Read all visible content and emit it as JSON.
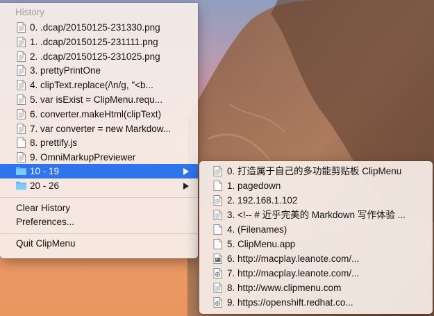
{
  "history_menu": {
    "header": "History",
    "items": [
      {
        "label": "0. .dcap/20150125-231330.png",
        "icon": "text-document-icon"
      },
      {
        "label": "1. .dcap/20150125-231111.png",
        "icon": "text-document-icon"
      },
      {
        "label": "2. .dcap/20150125-231025.png",
        "icon": "text-document-icon"
      },
      {
        "label": "3. prettyPrintOne",
        "icon": "text-document-icon"
      },
      {
        "label": "4. clipText.replace(/\\n/g, \"<b...",
        "icon": "text-document-icon"
      },
      {
        "label": "5. var isExist = ClipMenu.requ...",
        "icon": "text-document-icon"
      },
      {
        "label": "6. converter.makeHtml(clipText)",
        "icon": "text-document-icon"
      },
      {
        "label": "7. var converter = new Markdow...",
        "icon": "text-document-icon"
      },
      {
        "label": "8. prettify.js",
        "icon": "blank-document-icon"
      },
      {
        "label": "9. OmniMarkupPreviewer",
        "icon": "text-document-icon"
      }
    ],
    "folders": [
      {
        "label": "10 - 19",
        "icon": "folder-icon",
        "selected": true
      },
      {
        "label": "20 - 26",
        "icon": "folder-icon",
        "selected": false
      }
    ],
    "clear_history": "Clear History",
    "preferences": "Preferences...",
    "quit": "Quit ClipMenu"
  },
  "submenu": {
    "items": [
      {
        "label": "0. 打造属于自己的多功能剪贴板 ClipMenu",
        "icon": "text-document-icon"
      },
      {
        "label": "1. pagedown",
        "icon": "blank-document-icon"
      },
      {
        "label": "2. 192.168.1.102",
        "icon": "text-document-icon"
      },
      {
        "label": "3. <!-- # 近乎完美的 Markdown 写作体验 ...",
        "icon": "text-document-icon"
      },
      {
        "label": "4. (Filenames)",
        "icon": "blank-document-icon"
      },
      {
        "label": "5. ClipMenu.app",
        "icon": "blank-document-icon"
      },
      {
        "label": "6. http://macplay.leanote.com/...",
        "icon": "image-document-icon"
      },
      {
        "label": "7. http://macplay.leanote.com/...",
        "icon": "link-document-icon"
      },
      {
        "label": "8. http://www.clipmenu.com",
        "icon": "text-document-icon"
      },
      {
        "label": "9. https://openshift.redhat.co...",
        "icon": "link-document-icon"
      }
    ]
  },
  "colors": {
    "selection": "#2f74ec",
    "menu_bg": "#f6eee8",
    "header_text": "#a59e9a"
  }
}
